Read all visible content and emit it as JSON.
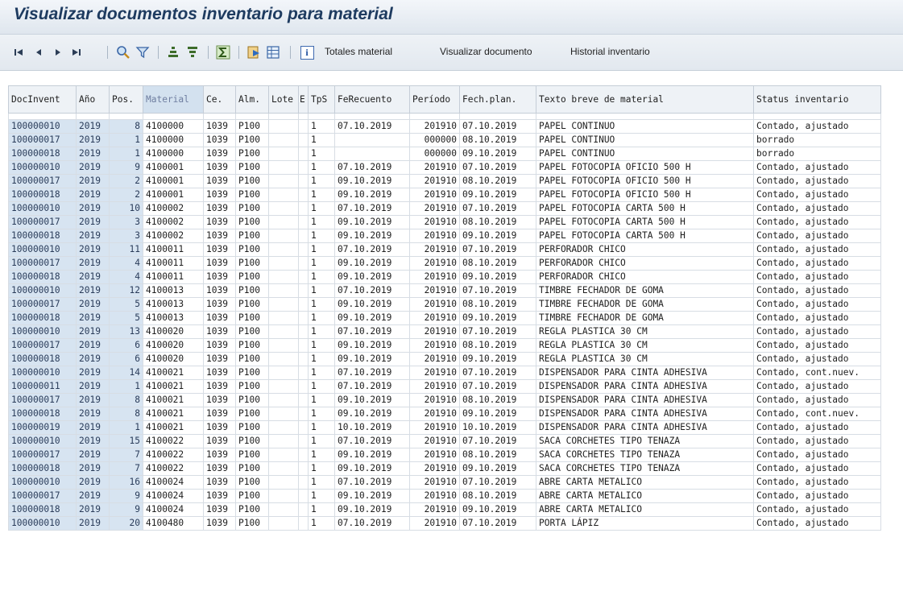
{
  "window": {
    "title": "Visualizar documentos inventario para material"
  },
  "toolbar": {
    "icons": [
      "first-page-icon",
      "previous-page-icon",
      "next-page-icon",
      "last-page-icon",
      "find-icon",
      "filter-icon",
      "sort-ascending-icon",
      "sort-descending-icon",
      "sum-icon",
      "export-icon",
      "spreadsheet-icon",
      "info-icon"
    ],
    "buttons": [
      "Totales material",
      "Visualizar documento",
      "Historial inventario"
    ]
  },
  "table": {
    "columns": [
      "DocInvent",
      "Año",
      "Pos.",
      "Material",
      "Ce.",
      "Alm.",
      "Lote",
      "E",
      "TpS",
      "FeRecuento",
      "Período",
      "Fech.plan.",
      "Texto breve de material",
      "Status inventario"
    ],
    "rows": [
      [
        "100000010",
        "2019",
        "8",
        "4100000",
        "1039",
        "P100",
        "",
        "",
        "1",
        "07.10.2019",
        "201910",
        "07.10.2019",
        "PAPEL CONTINUO",
        "Contado, ajustado"
      ],
      [
        "100000017",
        "2019",
        "1",
        "4100000",
        "1039",
        "P100",
        "",
        "",
        "1",
        "",
        "000000",
        "08.10.2019",
        "PAPEL CONTINUO",
        "borrado"
      ],
      [
        "100000018",
        "2019",
        "1",
        "4100000",
        "1039",
        "P100",
        "",
        "",
        "1",
        "",
        "000000",
        "09.10.2019",
        "PAPEL CONTINUO",
        "borrado"
      ],
      [
        "100000010",
        "2019",
        "9",
        "4100001",
        "1039",
        "P100",
        "",
        "",
        "1",
        "07.10.2019",
        "201910",
        "07.10.2019",
        "PAPEL FOTOCOPIA OFICIO 500 H",
        "Contado, ajustado"
      ],
      [
        "100000017",
        "2019",
        "2",
        "4100001",
        "1039",
        "P100",
        "",
        "",
        "1",
        "09.10.2019",
        "201910",
        "08.10.2019",
        "PAPEL FOTOCOPIA OFICIO 500 H",
        "Contado, ajustado"
      ],
      [
        "100000018",
        "2019",
        "2",
        "4100001",
        "1039",
        "P100",
        "",
        "",
        "1",
        "09.10.2019",
        "201910",
        "09.10.2019",
        "PAPEL FOTOCOPIA OFICIO 500 H",
        "Contado, ajustado"
      ],
      [
        "100000010",
        "2019",
        "10",
        "4100002",
        "1039",
        "P100",
        "",
        "",
        "1",
        "07.10.2019",
        "201910",
        "07.10.2019",
        "PAPEL FOTOCOPIA CARTA 500 H",
        "Contado, ajustado"
      ],
      [
        "100000017",
        "2019",
        "3",
        "4100002",
        "1039",
        "P100",
        "",
        "",
        "1",
        "09.10.2019",
        "201910",
        "08.10.2019",
        "PAPEL FOTOCOPIA CARTA 500 H",
        "Contado, ajustado"
      ],
      [
        "100000018",
        "2019",
        "3",
        "4100002",
        "1039",
        "P100",
        "",
        "",
        "1",
        "09.10.2019",
        "201910",
        "09.10.2019",
        "PAPEL FOTOCOPIA CARTA 500 H",
        "Contado, ajustado"
      ],
      [
        "100000010",
        "2019",
        "11",
        "4100011",
        "1039",
        "P100",
        "",
        "",
        "1",
        "07.10.2019",
        "201910",
        "07.10.2019",
        "PERFORADOR CHICO",
        "Contado, ajustado"
      ],
      [
        "100000017",
        "2019",
        "4",
        "4100011",
        "1039",
        "P100",
        "",
        "",
        "1",
        "09.10.2019",
        "201910",
        "08.10.2019",
        "PERFORADOR CHICO",
        "Contado, ajustado"
      ],
      [
        "100000018",
        "2019",
        "4",
        "4100011",
        "1039",
        "P100",
        "",
        "",
        "1",
        "09.10.2019",
        "201910",
        "09.10.2019",
        "PERFORADOR CHICO",
        "Contado, ajustado"
      ],
      [
        "100000010",
        "2019",
        "12",
        "4100013",
        "1039",
        "P100",
        "",
        "",
        "1",
        "07.10.2019",
        "201910",
        "07.10.2019",
        "TIMBRE FECHADOR DE GOMA",
        "Contado, ajustado"
      ],
      [
        "100000017",
        "2019",
        "5",
        "4100013",
        "1039",
        "P100",
        "",
        "",
        "1",
        "09.10.2019",
        "201910",
        "08.10.2019",
        "TIMBRE FECHADOR DE GOMA",
        "Contado, ajustado"
      ],
      [
        "100000018",
        "2019",
        "5",
        "4100013",
        "1039",
        "P100",
        "",
        "",
        "1",
        "09.10.2019",
        "201910",
        "09.10.2019",
        "TIMBRE FECHADOR DE GOMA",
        "Contado, ajustado"
      ],
      [
        "100000010",
        "2019",
        "13",
        "4100020",
        "1039",
        "P100",
        "",
        "",
        "1",
        "07.10.2019",
        "201910",
        "07.10.2019",
        "REGLA PLASTICA 30 CM",
        "Contado, ajustado"
      ],
      [
        "100000017",
        "2019",
        "6",
        "4100020",
        "1039",
        "P100",
        "",
        "",
        "1",
        "09.10.2019",
        "201910",
        "08.10.2019",
        "REGLA PLASTICA 30 CM",
        "Contado, ajustado"
      ],
      [
        "100000018",
        "2019",
        "6",
        "4100020",
        "1039",
        "P100",
        "",
        "",
        "1",
        "09.10.2019",
        "201910",
        "09.10.2019",
        "REGLA PLASTICA 30 CM",
        "Contado, ajustado"
      ],
      [
        "100000010",
        "2019",
        "14",
        "4100021",
        "1039",
        "P100",
        "",
        "",
        "1",
        "07.10.2019",
        "201910",
        "07.10.2019",
        "DISPENSADOR PARA CINTA ADHESIVA",
        "Contado, cont.nuev."
      ],
      [
        "100000011",
        "2019",
        "1",
        "4100021",
        "1039",
        "P100",
        "",
        "",
        "1",
        "07.10.2019",
        "201910",
        "07.10.2019",
        "DISPENSADOR PARA CINTA ADHESIVA",
        "Contado, ajustado"
      ],
      [
        "100000017",
        "2019",
        "8",
        "4100021",
        "1039",
        "P100",
        "",
        "",
        "1",
        "09.10.2019",
        "201910",
        "08.10.2019",
        "DISPENSADOR PARA CINTA ADHESIVA",
        "Contado, ajustado"
      ],
      [
        "100000018",
        "2019",
        "8",
        "4100021",
        "1039",
        "P100",
        "",
        "",
        "1",
        "09.10.2019",
        "201910",
        "09.10.2019",
        "DISPENSADOR PARA CINTA ADHESIVA",
        "Contado, cont.nuev."
      ],
      [
        "100000019",
        "2019",
        "1",
        "4100021",
        "1039",
        "P100",
        "",
        "",
        "1",
        "10.10.2019",
        "201910",
        "10.10.2019",
        "DISPENSADOR PARA CINTA ADHESIVA",
        "Contado, ajustado"
      ],
      [
        "100000010",
        "2019",
        "15",
        "4100022",
        "1039",
        "P100",
        "",
        "",
        "1",
        "07.10.2019",
        "201910",
        "07.10.2019",
        "SACA CORCHETES TIPO TENAZA",
        "Contado, ajustado"
      ],
      [
        "100000017",
        "2019",
        "7",
        "4100022",
        "1039",
        "P100",
        "",
        "",
        "1",
        "09.10.2019",
        "201910",
        "08.10.2019",
        "SACA CORCHETES TIPO TENAZA",
        "Contado, ajustado"
      ],
      [
        "100000018",
        "2019",
        "7",
        "4100022",
        "1039",
        "P100",
        "",
        "",
        "1",
        "09.10.2019",
        "201910",
        "09.10.2019",
        "SACA CORCHETES TIPO TENAZA",
        "Contado, ajustado"
      ],
      [
        "100000010",
        "2019",
        "16",
        "4100024",
        "1039",
        "P100",
        "",
        "",
        "1",
        "07.10.2019",
        "201910",
        "07.10.2019",
        "ABRE CARTA METALICO",
        "Contado, ajustado"
      ],
      [
        "100000017",
        "2019",
        "9",
        "4100024",
        "1039",
        "P100",
        "",
        "",
        "1",
        "09.10.2019",
        "201910",
        "08.10.2019",
        "ABRE CARTA METALICO",
        "Contado, ajustado"
      ],
      [
        "100000018",
        "2019",
        "9",
        "4100024",
        "1039",
        "P100",
        "",
        "",
        "1",
        "09.10.2019",
        "201910",
        "09.10.2019",
        "ABRE CARTA METALICO",
        "Contado, ajustado"
      ],
      [
        "100000010",
        "2019",
        "20",
        "4100480",
        "1039",
        "P100",
        "",
        "",
        "1",
        "07.10.2019",
        "201910",
        "07.10.2019",
        "PORTA LÁPIZ",
        "Contado, ajustado"
      ]
    ]
  }
}
